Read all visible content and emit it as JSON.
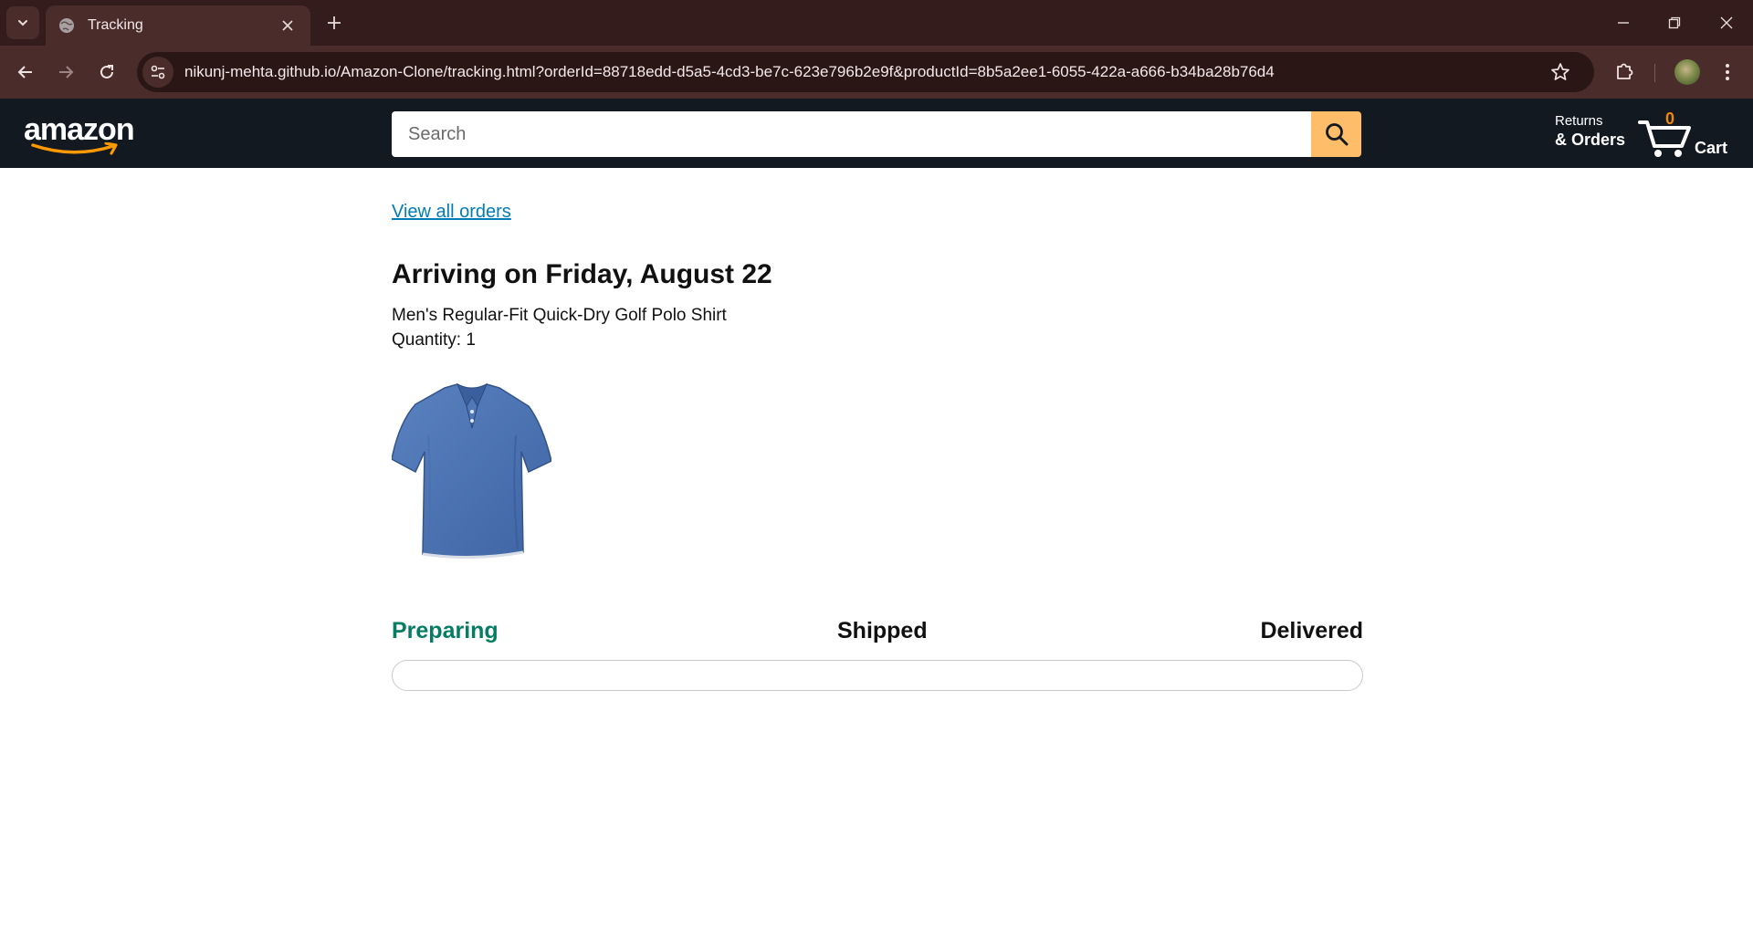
{
  "browser": {
    "tab_title": "Tracking",
    "url": "nikunj-mehta.github.io/Amazon-Clone/tracking.html?orderId=88718edd-d5a5-4cd3-be7c-623e796b2e9f&productId=8b5a2ee1-6055-422a-a666-b34ba28b76d4",
    "icons": [
      "chevron-down-icon",
      "globe-icon",
      "close-icon",
      "plus-icon",
      "minimize-icon",
      "restore-icon",
      "back-icon",
      "forward-icon",
      "reload-icon",
      "site-info-icon",
      "star-icon",
      "extensions-icon",
      "kebab-menu-icon"
    ]
  },
  "header": {
    "logo_text": "amazon",
    "search_placeholder": "Search",
    "returns_top": "Returns",
    "returns_bottom": "& Orders",
    "cart_count": "0",
    "cart_label": "Cart"
  },
  "tracking": {
    "view_all_orders": "View all orders",
    "arrival": "Arriving on Friday, August 22",
    "product_name": "Men's Regular-Fit Quick-Dry Golf Polo Shirt",
    "quantity": "Quantity: 1",
    "product_image": "blue-polo-shirt",
    "stages": [
      "Preparing",
      "Shipped",
      "Delivered"
    ],
    "current_stage": "Preparing",
    "progress_percent": 0,
    "colors": {
      "current_stage": "#067d62",
      "link": "#017cb6",
      "header_bg": "#131921",
      "search_button": "#febd69",
      "cart_count": "#f08804"
    }
  }
}
